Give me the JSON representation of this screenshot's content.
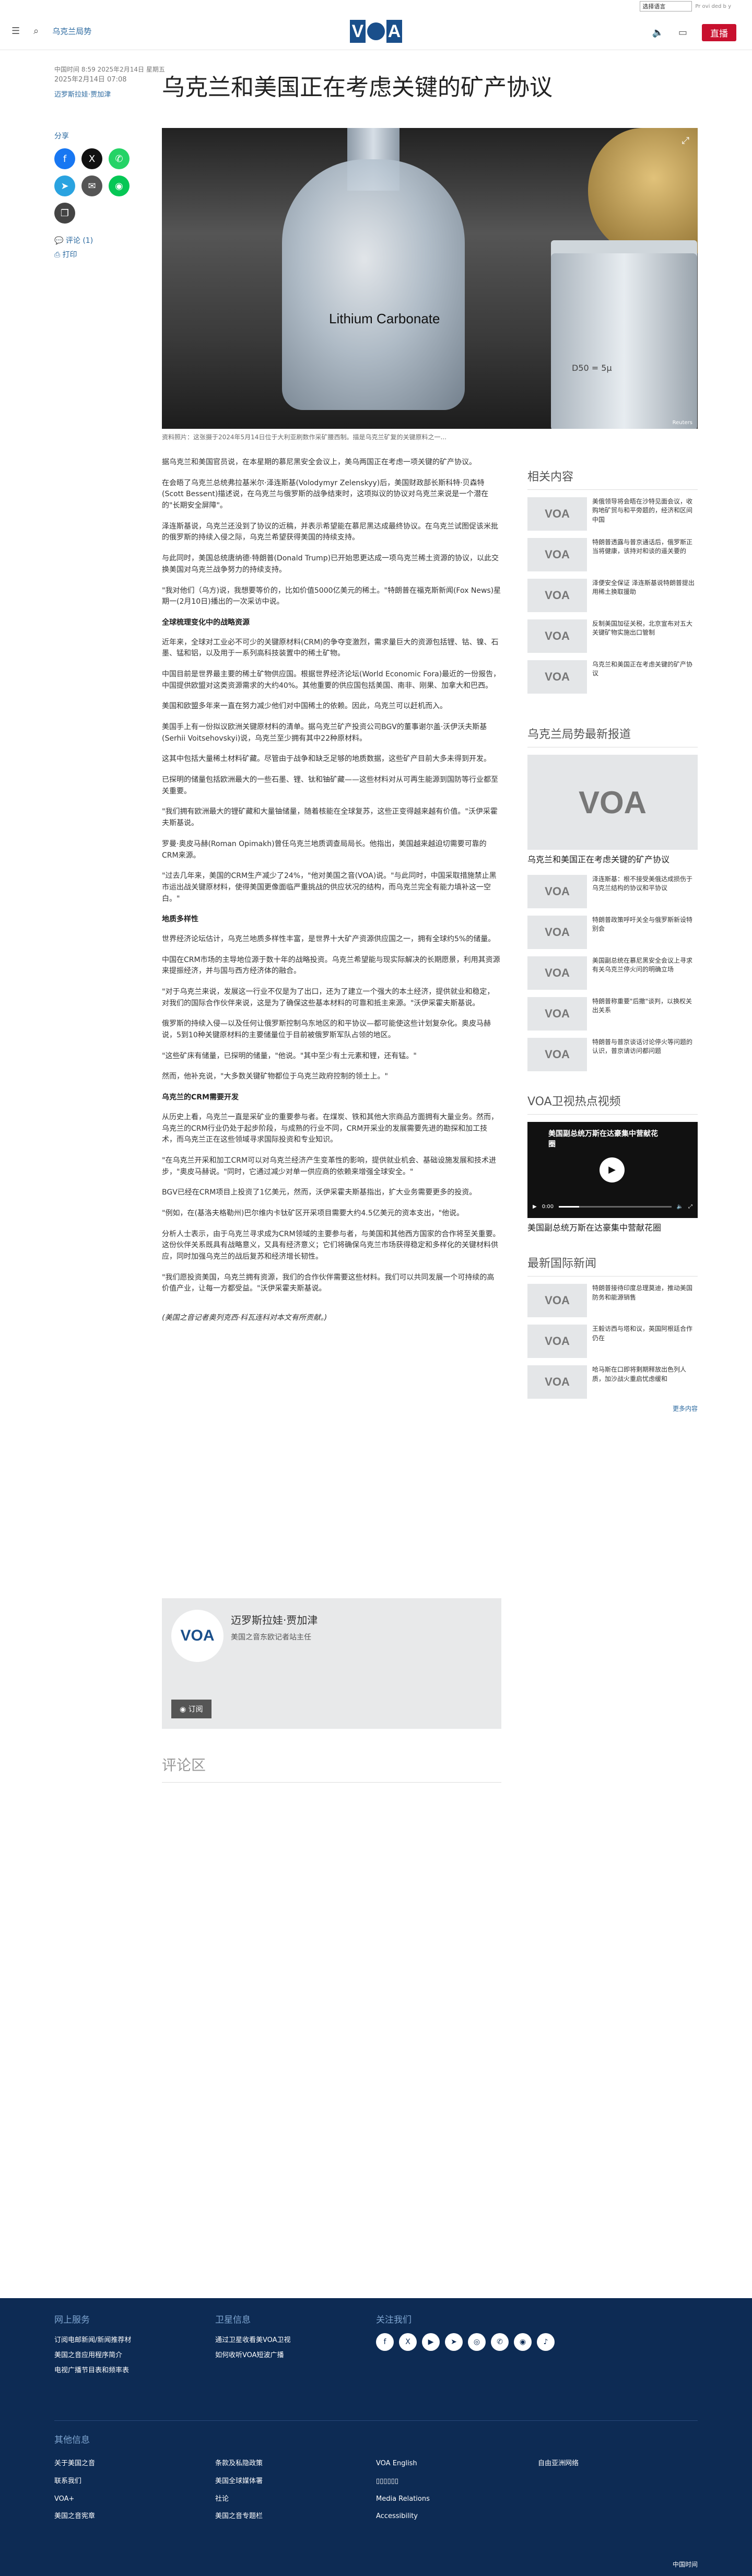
{
  "lang_bar": {
    "select_value": "选择语言",
    "note": "Pr ovi ded b y"
  },
  "header": {
    "section": "乌克兰局势",
    "logo": "VOA",
    "live_label": "直播"
  },
  "article": {
    "updated": "中国时间 8:59 2025年2月14日 星期五",
    "date": "2025年2月14日 07:08",
    "author_link": "迈罗斯拉娃·贾加津",
    "title": "乌克兰和美国正在考虑关键的矿产协议",
    "share_label": "分享",
    "comment_link": "评论 (1)",
    "print_link": "打印",
    "image_label": "Lithium Carbonate",
    "image_label2": "D50 = 5μ",
    "image_credit": "Reuters",
    "caption": "资料照片：这张摄于2024年5月14日位于大利亚刷数作采矿腰西制。描是乌克兰矿复的关键原料之一...",
    "paragraphs": [
      "据乌克兰和美国官员说，在本星期的慕尼黑安全会议上，美乌两国正在考虑一项关键的矿产协议。",
      "在会晤了乌克兰总统弗拉基米尔·泽连斯基(Volodymyr Zelenskyy)后，美国财政部长斯科特·贝森特(Scott Bessent)描述说，在乌克兰与俄罗斯的战争结束时，这项拟议的协议对乌克兰来说是一个潜在的\"长期安全屏障\"。",
      "泽连斯基说，乌克兰还没到了协议的近稿，并表示希望能在慕尼黑达成最终协议。在乌克兰试图促该米批的俄罗斯的持续入侵之际，乌克兰希望获得美国的持续支持。",
      "与此同时，美国总统唐纳德·特朗普(Donald Trump)已开始思更达成一项乌克兰稀土资源的协议，以此交换美国对乌克兰战争努力的持续支持。",
      "\"我对他们（乌方)说，我想要等价的，比如价值5000亿美元的稀土。\"特朗普在福克斯新闻(Fox News)星期一(2月10日)播出的一次采访中说。",
      "近年来，全球对工业必不可少的关键原材料(CRM)的争夺变激烈，需求量巨大的资源包括锂、钴、镍、石墨、锰和铝，以及用于一系列高科技装置中的稀土矿物。",
      "中国目前是世界最主要的稀土矿物供应国。根据世界经济论坛(World Economic Fora)最近的一份报告，中国提供欧盟对这类资源需求的大约40%。其他重要的供应国包括美国、南非、刚果、加拿大和巴西。",
      "美国和欧盟多年来一直在努力减少他们对中国稀土的依赖。因此，乌克兰可以赶机而入。",
      "美国手上有一份拟议欧洲关键原材料的清单。据乌克兰矿产投资公司BGV的董事谢尔盖·沃伊沃夫斯基(Serhii Voitsehovskyi)说，乌克兰至少拥有其中22种原材料。",
      "这其中包括大量稀土材料矿藏。尽管由于战争和缺乏足够的地质数据，这些矿产目前大多未得到开发。",
      "已探明的储量包括欧洲最大的一些石墨、锂、钛和铀矿藏——这些材料对从可再生能源到国防等行业都至关重要。",
      "\"我们拥有欧洲最大的锂矿藏和大量铀储量，随着核能在全球复苏，这些正变得越来越有价值。\"沃伊采霍夫斯基说。",
      "罗曼·奥皮马赫(Roman Opimakh)曾任乌克兰地质调查局局长。他指出，美国越来越迫切需要可靠的CRM来源。",
      "\"过去几年来，美国的CRM生产减少了24%，\"他对美国之音(VOA)说。\"与此同时，中国采取措施禁止黑市运出战关键原材料，使得美国更像面临严重挑战的供应状况的结构，而乌克兰完全有能力填补这一空白。\"",
      "世界经济论坛估计，乌克兰地质多样性丰富，是世界十大矿产资源供应国之一，拥有全球约5%的储量。",
      "中国在CRM市场的主导地位源于数十年的战略投资。乌克兰希望能与现实际解决的长期愿景，利用其资源来提振经济，并与国与西方经济体的融合。",
      "\"对于乌克兰来说，发展这一行业不仅是为了出口，还为了建立一个强大的本土经济，提供就业和稳定，对我们的国际合作伙伴来说，这是为了确保这些基本材料的可靠和抵主来源。\"沃伊采霍夫斯基说。",
      "俄罗斯的持续入侵—以及任何让俄罗斯控制乌东地区的和平协议—都可能使这些计划复杂化。奥皮马赫说，5到10种关键原材料的主要储量位于目前被俄罗斯军队占领的地区。",
      "\"这些矿床有储量，已探明的储量，\"他说。\"其中至少有土元素和锂，还有锰。\"",
      "然而，他补充说，\"大多数关键矿物都位于乌克兰政府控制的领土上。\"",
      "从历史上看，乌克兰一直是采矿业的重要参与者。在煤炭、铁和其他大宗商品方面拥有大量业务。然而，乌克兰的CRM行业仍处于起步阶段，与成熟的行业不同，CRM开采业的发展需要先进的勘探和加工技术，而乌克兰正在这些领域寻求国际投资和专业知识。",
      "\"在乌克兰开采和加工CRM可以对乌克兰经济产生变革性的影响，提供就业机会、基础设施发展和技术进步，\"奥皮马赫说。\"同时，它通过减少对单一供应商的依赖来增强全球安全。\"",
      "BGV已经在CRM项目上投资了1亿美元，然而，沃伊采霍夫斯基指出，扩大业务需要更多的投资。",
      "\"例如，在(基洛夫格勒州)巴尔维内卡钛矿区开采项目需要大约4.5亿美元的资本支出，\"他说。",
      "分析人士表示，由于乌克兰寻求成为CRM领域的主要参与者，与美国和其他西方国家的合作将至关重要。这份伙伴关系既具有战略意义，又具有经济意义；它们将确保乌克兰市场获得稳定和多样化的关键材料供应，同时加强乌克兰的战后复苏和经济增长韧性。",
      "\"我们愿投资美国，乌克兰拥有资源，我们的合作伙伴需要这些材料。我们可以共同发展一个可持续的高价值产业，让每一方都受益。\"沃伊采霍夫斯基说。",
      "(美国之音记者奥列克西·科瓦连科对本文有所贡献。)"
    ],
    "headings": [
      "全球梳理变化中的战略资源",
      "地质多样性",
      "乌克兰的CRM需要开发"
    ]
  },
  "author_box": {
    "name": "迈罗斯拉娃·贾加津",
    "role": "美国之音东欧记者站主任",
    "rss": "订阅"
  },
  "comments": {
    "label": "评论区"
  },
  "sidebar": {
    "related_title": "相关内容",
    "related": [
      "美俄领导将会晤在沙特见面会议，收购地矿贸与和平旁题的，经济和区间中国",
      "特朗普透露与普京通话后，俄罗斯正当将健康，该持对和谈的遥关要的",
      "泽便安全保证 泽连斯基说特朗普提出用稀土换取援助",
      "反制美国加征关税，北京宣布对五大关键矿物实施出口管制",
      "乌克兰和美国正在考虑关键的矿产协议"
    ],
    "latest_title": "乌克兰局势最新报道",
    "latest_big": "乌克兰和美国正在考虑关键的矿产协议",
    "latest": [
      "泽连斯基：根不接受美俄达成损伤于乌克兰结构的协议和平协议",
      "特朗普政策呼吁关全与俄罗斯新设特别会",
      "美国副总统在慕尼黑安全会议上寻求有关乌克兰停火问的明确立场",
      "特朗普称重要\"后撤\"谈判，以换权关出关系",
      "特朗普与普京谈话讨论停火等问题的认识，普京请访问都问题"
    ],
    "video_title": "VOA卫视热点视频",
    "video_caption": "美国副总统万斯在达豪集中营献花圈",
    "video_time": "0:00",
    "intl_title": "最新国际新闻",
    "intl": [
      "特朗普接待印度总理莫迪，推动美国防务和能源销售",
      "王毅访西与塔和议，英国阿根廷合作仍在",
      "哈马斯在口即将剩期释放出色列人质，加沙战火重启忧虑缓和"
    ],
    "more": "更多内容"
  },
  "footer": {
    "col1_title": "网上服务",
    "col1": [
      "订阅电邮新闻/新闻推荐材",
      "美国之音应用程序简介",
      "电视广播节目表和频率表"
    ],
    "col2_title": "卫星信息",
    "col2": [
      "通过卫星收看美VOA卫视",
      "如何收听VOA短波广播"
    ],
    "col3_title": "关注我们",
    "other_title": "其他信息",
    "bottom_col1": [
      "关于美国之音",
      "联系我们",
      "VOA+",
      "美国之音宪章"
    ],
    "bottom_col2": [
      "条款及私隐政策",
      "美国全球媒体署",
      "社论",
      "美国之音专题栏"
    ],
    "bottom_col3": [
      "VOA English",
      "▯▯▯▯▯▯",
      "Media Relations",
      "Accessibility"
    ],
    "bottom_col4": [
      "自由亚洲网络"
    ],
    "bottom_right": "中国时间"
  }
}
